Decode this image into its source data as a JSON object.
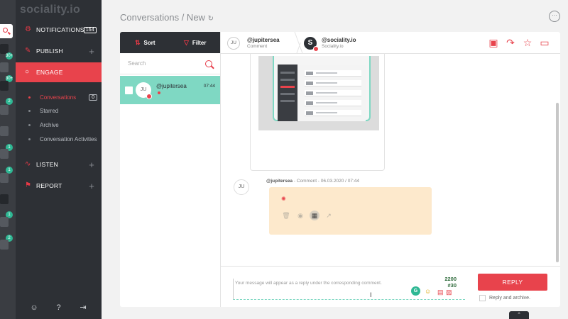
{
  "app": {
    "logo": "sociality.io"
  },
  "header": {
    "title": "Conversations / New",
    "refresh_icon": "refresh-icon",
    "more_icon": "more-icon"
  },
  "rail": {
    "badges": [
      "30+",
      "30+",
      "2",
      "1",
      "1",
      "1",
      "2",
      "4"
    ],
    "accent": "#2fb894"
  },
  "sidebar": {
    "items": [
      {
        "label": "NOTIFICATIONS",
        "icon": "gear-icon",
        "badge": "164"
      },
      {
        "label": "PUBLISH",
        "icon": "pencil-icon"
      },
      {
        "label": "ENGAGE",
        "icon": "chat-icon"
      },
      {
        "label": "LISTEN",
        "icon": "pulse-icon"
      },
      {
        "label": "REPORT",
        "icon": "flag-icon"
      }
    ],
    "engage_sub": [
      {
        "label": "Conversations",
        "count": "0"
      },
      {
        "label": "Starred"
      },
      {
        "label": "Archive"
      },
      {
        "label": "Conversation Activities"
      }
    ],
    "bottom": [
      "user-icon",
      "help-icon",
      "logout-icon"
    ],
    "bottom_glyphs": [
      "☺",
      "?",
      "⇥"
    ]
  },
  "list": {
    "sort_label": "Sort",
    "filter_label": "Filter",
    "search_placeholder": "Search",
    "items": [
      {
        "initials": "JU",
        "name": "@jupitersea",
        "time": "07:44"
      }
    ]
  },
  "detail": {
    "from": {
      "initials": "JU",
      "name": "@jupitersea",
      "sub": "Comment"
    },
    "to": {
      "initial": "S",
      "name": "@sociality.io",
      "sub": "Sociality.io"
    },
    "actions": [
      "calendar-icon",
      "share-icon",
      "star-icon",
      "folder-check-icon"
    ],
    "comment": {
      "initials": "JU",
      "author": "@jupitersea",
      "meta": " - Comment - 06.03.2020 / 07:44"
    }
  },
  "composer": {
    "placeholder": "Your message will appear as a reply under the corresponding comment.",
    "count": "2200",
    "hashtag_count": "#30",
    "reply_label": "REPLY",
    "archive_label": "Reply and archive."
  },
  "colors": {
    "brand": "#e8434c",
    "selected": "#7fd8c3",
    "dark": "#2d3035"
  }
}
